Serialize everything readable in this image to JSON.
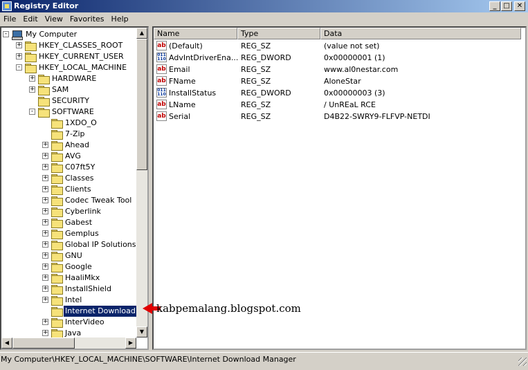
{
  "window": {
    "title": "Registry Editor"
  },
  "menu": [
    "File",
    "Edit",
    "View",
    "Favorites",
    "Help"
  ],
  "tree": [
    {
      "label": "My Computer",
      "level": 0,
      "expander": "-",
      "icon": "computer-icon"
    },
    {
      "label": "HKEY_CLASSES_ROOT",
      "level": 1,
      "expander": "+"
    },
    {
      "label": "HKEY_CURRENT_USER",
      "level": 1,
      "expander": "+"
    },
    {
      "label": "HKEY_LOCAL_MACHINE",
      "level": 1,
      "expander": "-"
    },
    {
      "label": "HARDWARE",
      "level": 2,
      "expander": "+"
    },
    {
      "label": "SAM",
      "level": 2,
      "expander": "+"
    },
    {
      "label": "SECURITY",
      "level": 2,
      "expander": ""
    },
    {
      "label": "SOFTWARE",
      "level": 2,
      "expander": "-"
    },
    {
      "label": "1XDO_O",
      "level": 3,
      "expander": ""
    },
    {
      "label": "7-Zip",
      "level": 3,
      "expander": ""
    },
    {
      "label": "Ahead",
      "level": 3,
      "expander": "+"
    },
    {
      "label": "AVG",
      "level": 3,
      "expander": "+"
    },
    {
      "label": "C07ft5Y",
      "level": 3,
      "expander": "+"
    },
    {
      "label": "Classes",
      "level": 3,
      "expander": "+"
    },
    {
      "label": "Clients",
      "level": 3,
      "expander": "+"
    },
    {
      "label": "Codec Tweak Tool",
      "level": 3,
      "expander": "+"
    },
    {
      "label": "Cyberlink",
      "level": 3,
      "expander": "+"
    },
    {
      "label": "Gabest",
      "level": 3,
      "expander": "+"
    },
    {
      "label": "Gemplus",
      "level": 3,
      "expander": "+"
    },
    {
      "label": "Global IP Solutions",
      "level": 3,
      "expander": "+"
    },
    {
      "label": "GNU",
      "level": 3,
      "expander": "+"
    },
    {
      "label": "Google",
      "level": 3,
      "expander": "+"
    },
    {
      "label": "HaaliMkx",
      "level": 3,
      "expander": "+"
    },
    {
      "label": "InstallShield",
      "level": 3,
      "expander": "+"
    },
    {
      "label": "Intel",
      "level": 3,
      "expander": "+"
    },
    {
      "label": "Internet Download Ma",
      "level": 3,
      "expander": "",
      "selected": true
    },
    {
      "label": "InterVideo",
      "level": 3,
      "expander": "+"
    },
    {
      "label": "Java",
      "level": 3,
      "expander": "+"
    }
  ],
  "columns": [
    "Name",
    "Type",
    "Data"
  ],
  "values": [
    {
      "name": "(Default)",
      "type": "REG_SZ",
      "data": "(value not set)",
      "kind": "sz"
    },
    {
      "name": "AdvIntDriverEna...",
      "type": "REG_DWORD",
      "data": "0x00000001 (1)",
      "kind": "dword"
    },
    {
      "name": "Email",
      "type": "REG_SZ",
      "data": "www.al0nestar.com",
      "kind": "sz"
    },
    {
      "name": "FName",
      "type": "REG_SZ",
      "data": "AloneStar",
      "kind": "sz"
    },
    {
      "name": "InstallStatus",
      "type": "REG_DWORD",
      "data": "0x00000003 (3)",
      "kind": "dword"
    },
    {
      "name": "LName",
      "type": "REG_SZ",
      "data": "/ UnREaL RCE",
      "kind": "sz"
    },
    {
      "name": "Serial",
      "type": "REG_SZ",
      "data": "D4B22-SWRY9-FLFVP-NETDI",
      "kind": "sz"
    }
  ],
  "status": "My Computer\\HKEY_LOCAL_MACHINE\\SOFTWARE\\Internet Download Manager",
  "watermark": "kabpemalang.blogspot.com",
  "colors": {
    "title_start": "#0a246a",
    "title_end": "#a6caf0",
    "selection": "#0a246a",
    "arrow": "#e00000"
  }
}
